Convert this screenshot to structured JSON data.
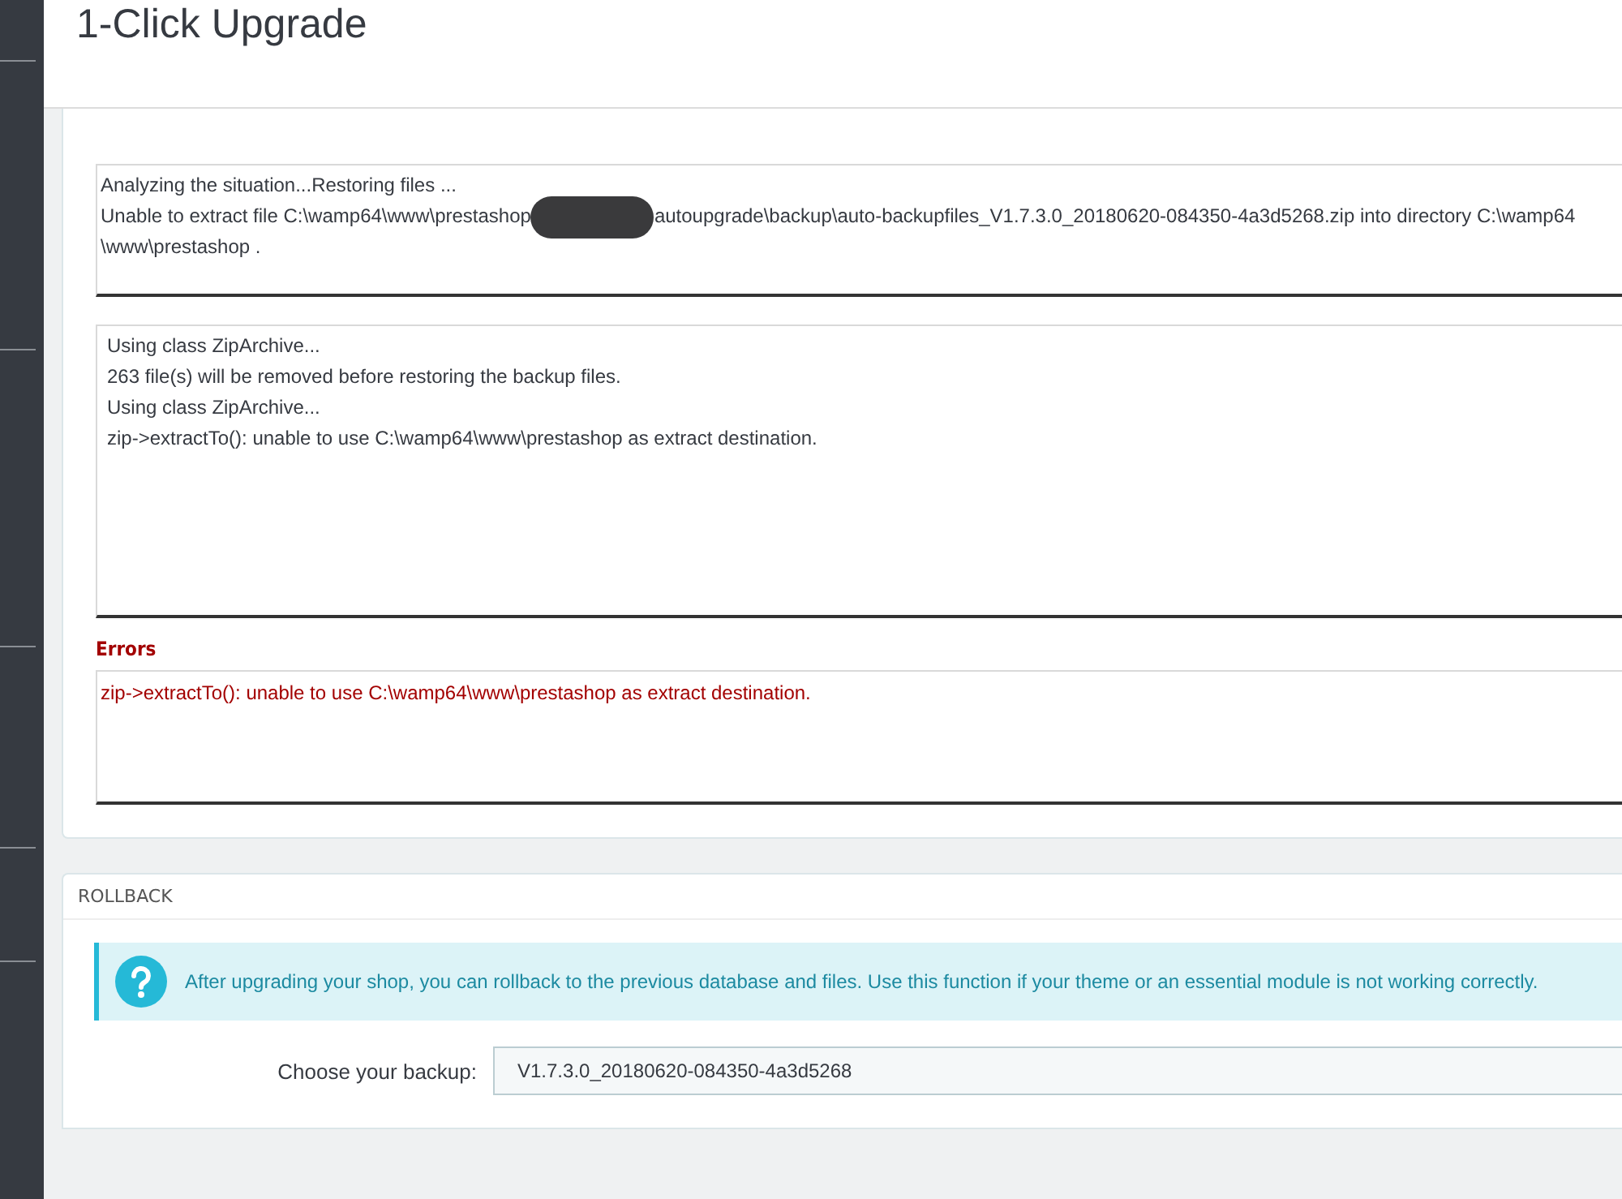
{
  "page_title": "1-Click Upgrade",
  "status_log": {
    "lines": [
      "Analyzing the situation...Restoring files ..."
    ],
    "redacted_line": {
      "before": "Unable to extract file C:\\wamp64\\www\\prestashop",
      "after": "autoupgrade\\backup\\auto-backupfiles_V1.7.3.0_20180620-084350-4a3d5268.zip into directory C:\\wamp64"
    },
    "tail_lines": [
      "\\www\\prestashop ."
    ]
  },
  "detail_log": {
    "lines": [
      "Using class ZipArchive...",
      "263 file(s) will be removed before restoring the backup files.",
      "Using class ZipArchive...",
      "zip->extractTo(): unable to use C:\\wamp64\\www\\prestashop as extract destination."
    ]
  },
  "errors": {
    "label": "Errors",
    "lines": [
      "zip->extractTo(): unable to use C:\\wamp64\\www\\prestashop as extract destination."
    ]
  },
  "rollback": {
    "header": "ROLLBACK",
    "info": "After upgrading your shop, you can rollback to the previous database and files. Use this function if your theme or an essential module is not working correctly.",
    "backup_label": "Choose your backup:",
    "backup_value": "V1.7.3.0_20180620-084350-4a3d5268"
  }
}
